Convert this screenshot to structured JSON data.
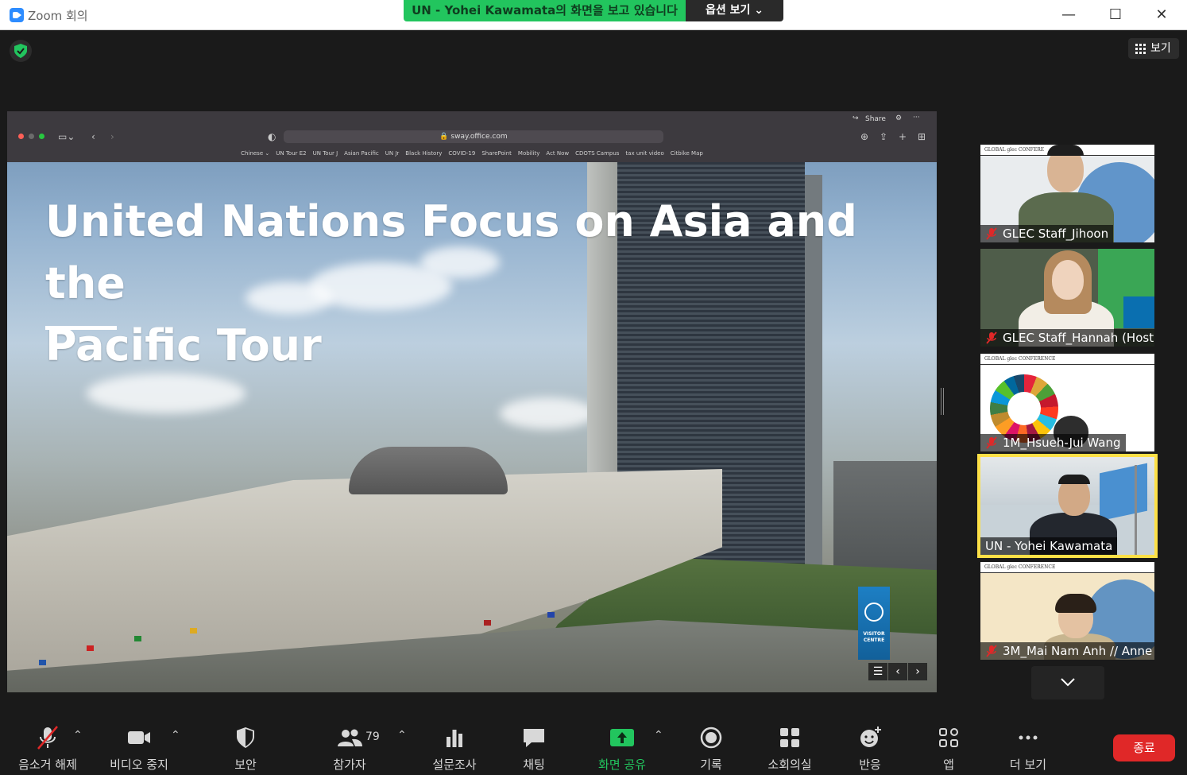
{
  "window": {
    "title": "Zoom 회의",
    "minimize": "—",
    "maximize": "☐",
    "close": "✕"
  },
  "share_banner": {
    "text": "UN - Yohei Kawamata의 화면을 보고 있습니다",
    "view_options": "옵션 보기 ⌄"
  },
  "top_right": {
    "view_label": "보기"
  },
  "browser": {
    "url": "sway.office.com",
    "share_label": "Share",
    "bookmarks": [
      "Chinese ⌄",
      "UN Tour E2",
      "UN Tour J",
      "Asian Pacific",
      "UN Jr",
      "Black History",
      "COVID-19",
      "SharePoint",
      "Mobility",
      "Act Now",
      "CDOTS Campus",
      "tax unit video",
      "Citbike Map"
    ]
  },
  "slide": {
    "title_line1": "United Nations Focus on Asia and the",
    "title_line2": "Pacific Tour",
    "sign_text": "VISITOR CENTRE"
  },
  "participants": [
    {
      "name": "GLEC Staff_Jihoon",
      "muted": true,
      "banner": "GLOBAL glec CONFERE"
    },
    {
      "name": "GLEC Staff_Hannah (Host)",
      "muted": true,
      "banner": ""
    },
    {
      "name": "1M_Hsueh-Jui Wang",
      "muted": true,
      "banner": "GLOBAL glec CONFERENCE"
    },
    {
      "name": "UN - Yohei Kawamata",
      "muted": false,
      "active": true,
      "banner": ""
    },
    {
      "name": "3M_Mai Nam Anh // Anne",
      "muted": true,
      "banner": "GLOBAL glec CONFERENCE"
    }
  ],
  "toolbar": {
    "unmute": "음소거 해제",
    "stop_video": "비디오 중지",
    "security": "보안",
    "participants": "참가자",
    "participants_count": "79",
    "polls": "설문조사",
    "chat": "채팅",
    "share_screen": "화면 공유",
    "record": "기록",
    "breakout": "소회의실",
    "reactions": "반응",
    "apps": "앱",
    "more": "더 보기",
    "end": "종료"
  },
  "colors": {
    "share_green": "#22c55e",
    "end_red": "#e02828",
    "active_outline": "#fde047",
    "zoom_blue": "#2d8cff"
  }
}
